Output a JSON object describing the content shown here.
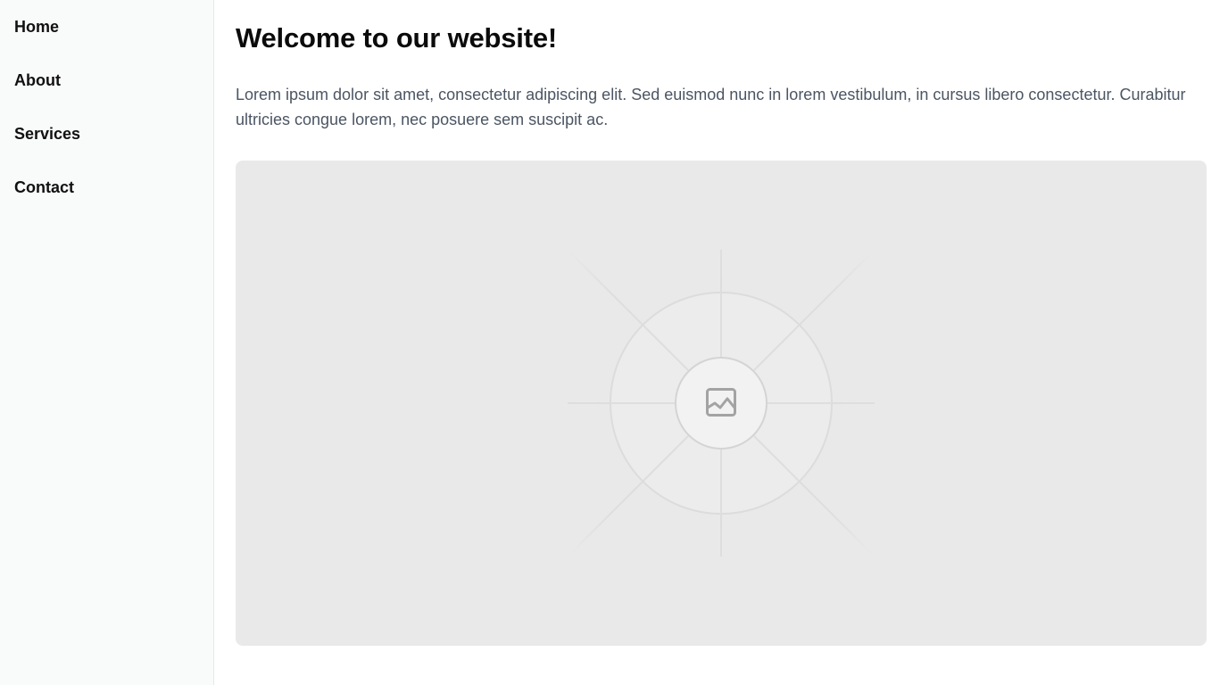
{
  "sidebar": {
    "items": [
      {
        "label": "Home"
      },
      {
        "label": "About"
      },
      {
        "label": "Services"
      },
      {
        "label": "Contact"
      }
    ]
  },
  "main": {
    "title": "Welcome to our website!",
    "intro": "Lorem ipsum dolor sit amet, consectetur adipiscing elit. Sed euismod nunc in lorem vestibulum, in cursus libero consectetur. Curabitur ultricies congue lorem, nec posuere sem suscipit ac.",
    "hero_image": {
      "icon": "image-placeholder-icon"
    }
  },
  "colors": {
    "sidebar_bg": "#f9fafa",
    "placeholder_bg": "#e9e9e9",
    "text_muted": "#4b5563"
  }
}
